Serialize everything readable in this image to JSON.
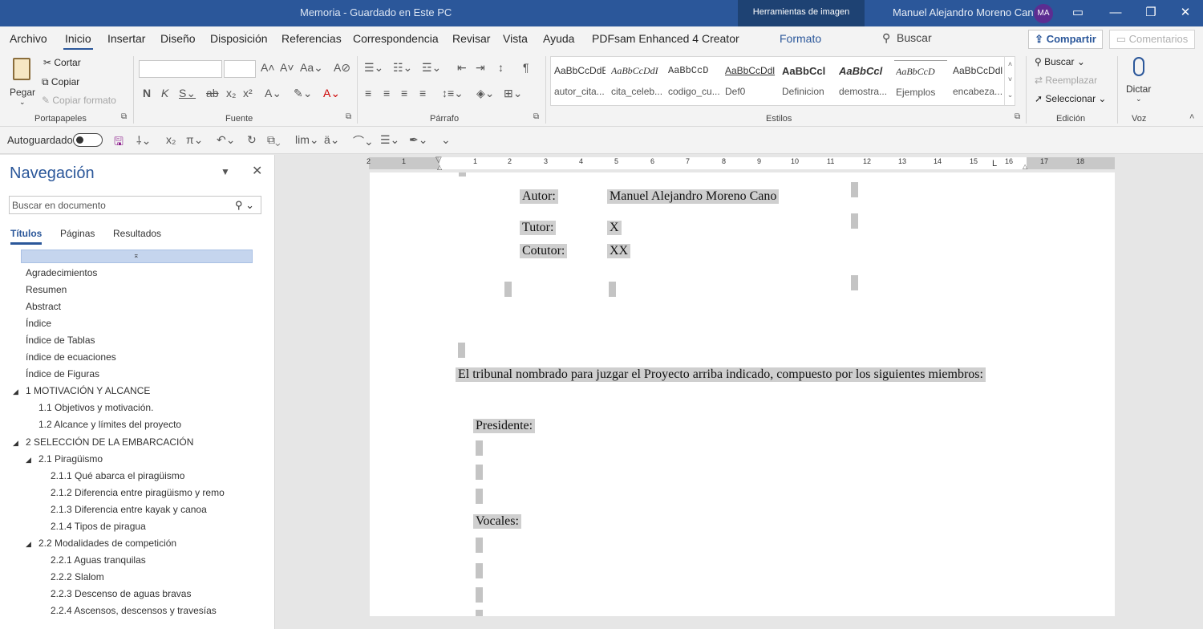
{
  "titlebar": {
    "title": "Memoria  -  Guardado en Este PC",
    "contextual_tab": "Herramientas de imagen",
    "user": "Manuel Alejandro Moreno Cano",
    "avatar_initials": "MA"
  },
  "menu": {
    "tabs": [
      "Archivo",
      "Inicio",
      "Insertar",
      "Diseño",
      "Disposición",
      "Referencias",
      "Correspondencia",
      "Revisar",
      "Vista",
      "Ayuda",
      "PDFsam Enhanced 4 Creator",
      "Formato"
    ],
    "active_tab": "Inicio",
    "search_label": "Buscar",
    "share_label": "Compartir",
    "comments_label": "Comentarios"
  },
  "ribbon": {
    "portapapeles": {
      "paste": "Pegar",
      "cut": "Cortar",
      "copy": "Copiar",
      "format_painter": "Copiar formato",
      "label": "Portapapeles"
    },
    "fuente": {
      "label": "Fuente"
    },
    "parrafo": {
      "label": "Párrafo"
    },
    "estilos": {
      "label": "Estilos",
      "items": [
        {
          "sample": "AaBbCcDdE",
          "name": "autor_cita..."
        },
        {
          "sample": "AaBbCcDdI",
          "name": "cita_celeb..."
        },
        {
          "sample": "AaBbCcD",
          "name": "codigo_cu..."
        },
        {
          "sample": "AaBbCcDdl",
          "name": "Def0"
        },
        {
          "sample": "AaBbCcl",
          "name": "Definicion"
        },
        {
          "sample": "AaBbCcl",
          "name": "demostra..."
        },
        {
          "sample": "AaBbCcD",
          "name": "Ejemplos"
        },
        {
          "sample": "AaBbCcDdl",
          "name": "encabeza..."
        }
      ]
    },
    "edicion": {
      "find": "Buscar",
      "replace": "Reemplazar",
      "select": "Seleccionar",
      "label": "Edición"
    },
    "voz": {
      "dictate": "Dictar",
      "label": "Voz"
    }
  },
  "qat": {
    "autosave_label": "Autoguardado"
  },
  "navigation": {
    "title": "Navegación",
    "search_placeholder": "Buscar en documento",
    "tabs": [
      "Títulos",
      "Páginas",
      "Resultados"
    ],
    "items": [
      {
        "text": "Agradecimientos"
      },
      {
        "text": "Resumen"
      },
      {
        "text": "Abstract"
      },
      {
        "text": "Índice"
      },
      {
        "text": "Índice de Tablas"
      },
      {
        "text": "índice de ecuaciones"
      },
      {
        "text": "Índice de Figuras"
      },
      {
        "text": "1 MOTIVACIÓN Y ALCANCE"
      },
      {
        "text": "1.1 Objetivos y motivación."
      },
      {
        "text": "1.2 Alcance y límites del proyecto"
      },
      {
        "text": "2 SELECCIÓN DE LA EMBARCACIÓN"
      },
      {
        "text": "2.1 Piragüismo"
      },
      {
        "text": "2.1.1 Qué abarca el piragüismo"
      },
      {
        "text": "2.1.2 Diferencia entre piragüismo y remo"
      },
      {
        "text": "2.1.3 Diferencia entre kayak y canoa"
      },
      {
        "text": "2.1.4 Tipos de piragua"
      },
      {
        "text": "2.2 Modalidades de competición"
      },
      {
        "text": "2.2.1 Aguas tranquilas"
      },
      {
        "text": "2.2.2 Slalom"
      },
      {
        "text": "2.2.3 Descenso de aguas bravas"
      },
      {
        "text": "2.2.4 Ascensos, descensos y travesías"
      }
    ]
  },
  "ruler": {
    "ticks": [
      "2",
      "1",
      "1",
      "2",
      "3",
      "4",
      "5",
      "6",
      "7",
      "8",
      "9",
      "10",
      "11",
      "12",
      "13",
      "14",
      "15",
      "16",
      "17",
      "18"
    ]
  },
  "document": {
    "autor_label": "Autor:",
    "autor_value": "Manuel Alejandro Moreno Cano",
    "tutor_label": "Tutor:",
    "tutor_value": "X",
    "cotutor_label": "Cotutor:",
    "cotutor_value": "XX",
    "tribunal_text": "El tribunal nombrado para juzgar el Proyecto arriba indicado, compuesto por los siguientes miembros:",
    "presidente_label": "Presidente:",
    "vocales_label": "Vocales:"
  }
}
